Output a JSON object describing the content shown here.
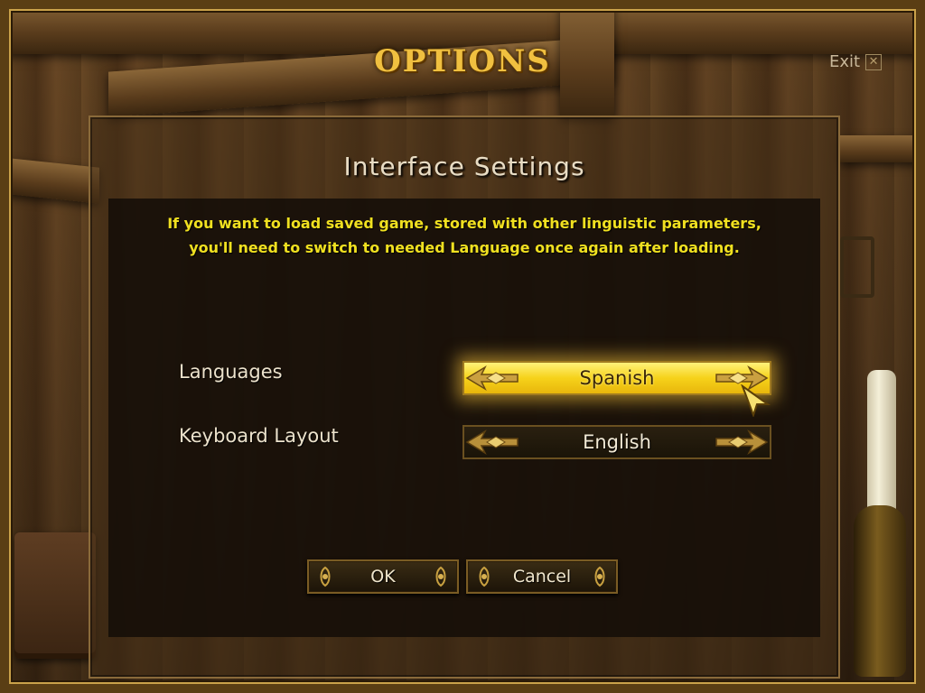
{
  "screen": {
    "title": "OPTIONS",
    "exit_label": "Exit",
    "exit_icon": "close-icon"
  },
  "panel": {
    "title": "Interface Settings",
    "notice": [
      "If you want to load saved game, stored with other linguistic parameters,",
      "you'll need to switch to needed Language once again after loading."
    ],
    "settings": [
      {
        "label": "Languages",
        "value": "Spanish",
        "highlighted": true
      },
      {
        "label": "Keyboard Layout",
        "value": "English",
        "highlighted": false
      }
    ]
  },
  "buttons": {
    "ok_label": "OK",
    "cancel_label": "Cancel"
  },
  "colors": {
    "title_gold": "#f0c040",
    "notice_yellow": "#f0e020",
    "highlight_yellow": "#f6d21a"
  }
}
